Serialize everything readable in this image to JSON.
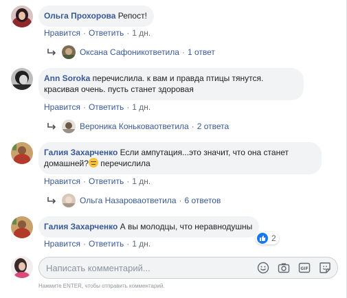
{
  "comments": [
    {
      "author": "Ольга Прохорова",
      "text": " Репост!",
      "actions": {
        "like": "Нравится",
        "reply": "Ответить",
        "time": "1 дн."
      },
      "reply_summary": {
        "name": "Оксана Сафоник",
        "verb": " ответила",
        "count": "1 ответ"
      }
    },
    {
      "author": "Ann Soroka",
      "text_line1": " перечислила. к вам и правда птицы тянутся.",
      "text_line2": "красивая очень. пусть станет здоровая",
      "actions": {
        "like": "Нравится",
        "reply": "Ответить",
        "time": "1 дн."
      },
      "reply_summary": {
        "name": "Вероника Конькова",
        "verb": " ответила",
        "count": "2 ответа"
      }
    },
    {
      "author": "Галия Захарченко",
      "text_line1": " Если ампутация...это значит, что она станет",
      "text_line2a": "домашней?",
      "text_line2b": " перечислила",
      "emoji": "disappointed-face-emoji",
      "actions": {
        "like": "Нравится",
        "reply": "Ответить",
        "time": "1 дн."
      },
      "reply_summary": {
        "name": "Ольга Назарова",
        "verb": " ответила",
        "count": "6 ответов"
      }
    },
    {
      "author": "Галия Захарченко",
      "text": " А вы молодцы, что неравнодушны",
      "actions": {
        "like": "Нравится",
        "reply": "Ответить",
        "time": "1 дн."
      },
      "reactions": {
        "icon": "like-icon",
        "count": "2"
      }
    }
  ],
  "separator": "·",
  "composer": {
    "placeholder": "Написать комментарий...",
    "icons": [
      "emoji-icon",
      "camera-icon",
      "gif-icon",
      "sticker-icon"
    ],
    "hint": "Нажмите ENTER, чтобы отправить комментарий."
  },
  "colors": {
    "link": "#385898",
    "bubble": "#f2f3f5",
    "meta": "#606770",
    "like_blue": "#1877f2"
  }
}
